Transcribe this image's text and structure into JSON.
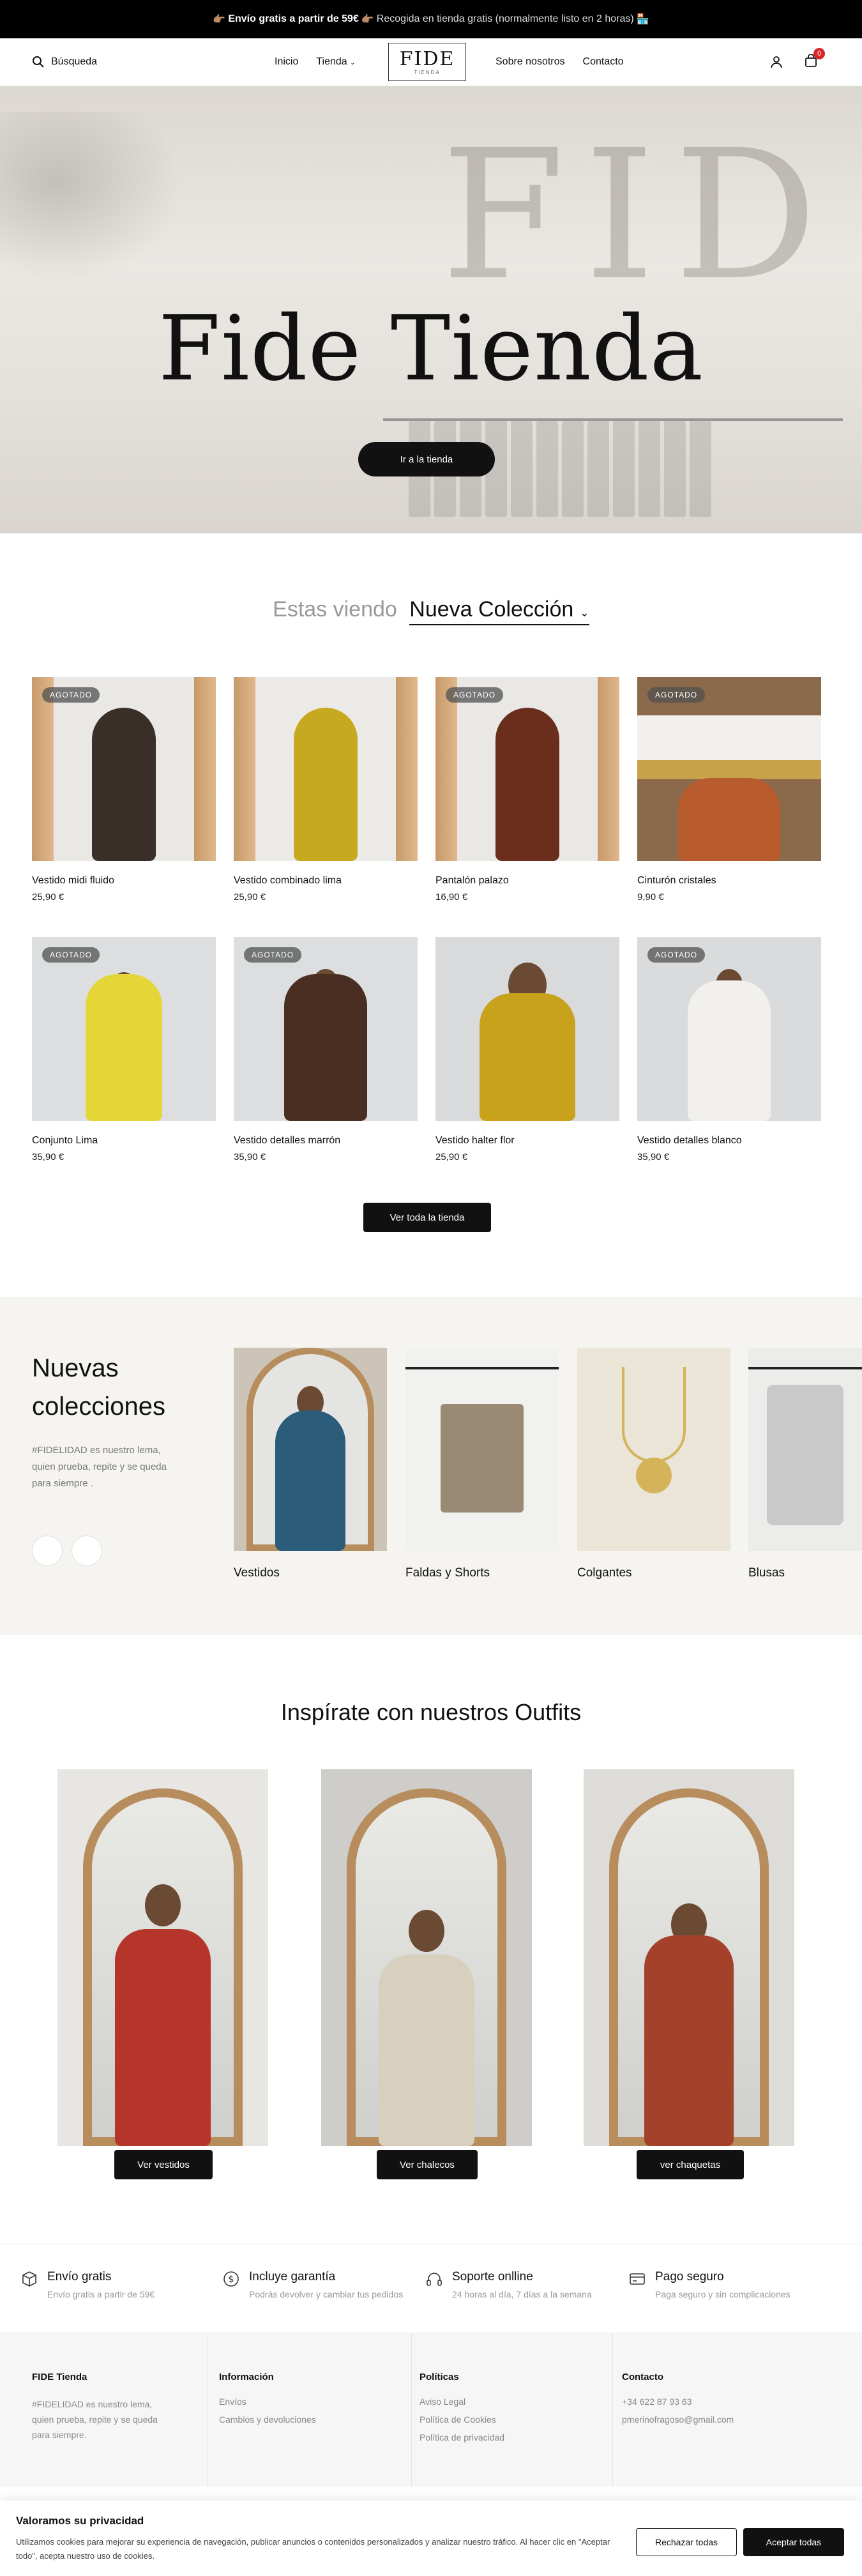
{
  "announcement": {
    "emoji_left": "👉🏽",
    "bold": "Envío gratis a partir de 59€",
    "emoji_mid": "👉🏽",
    "rest": "Recogida en tienda gratis (normalmente listo en 2 horas)",
    "emoji_right": "🏪"
  },
  "header": {
    "search_label": "Búsqueda",
    "nav": [
      "Inicio",
      "Tienda"
    ],
    "nav_right": [
      "Sobre nosotros",
      "Contacto"
    ],
    "logo_big": "FIDE",
    "logo_small": "TIENDA",
    "cart_count": "0"
  },
  "hero": {
    "title": "Fide Tienda",
    "button": "Ir a la tienda",
    "wall_text": "FID"
  },
  "collection": {
    "prefix": "Estas viendo",
    "selected": "Nueva Colección",
    "badge": "AGOTADO",
    "products": [
      {
        "name": "Vestido midi fluido",
        "price": "25,90 €",
        "soldout": true,
        "color": "#3a2f28"
      },
      {
        "name": "Vestido combinado lima",
        "price": "25,90 €",
        "soldout": false,
        "color": "#c6a91e"
      },
      {
        "name": "Pantalón palazo",
        "price": "16,90 €",
        "soldout": true,
        "color": "#6b2e1d"
      },
      {
        "name": "Cinturón cristales",
        "price": "9,90 €",
        "soldout": true,
        "color": "#b85c2e"
      },
      {
        "name": "Conjunto Lima",
        "price": "35,90 €",
        "soldout": true,
        "color": "#e4d636"
      },
      {
        "name": "Vestido detalles marrón",
        "price": "35,90 €",
        "soldout": true,
        "color": "#4a2e22"
      },
      {
        "name": "Vestido halter flor",
        "price": "25,90 €",
        "soldout": false,
        "color": "#c9a21c"
      },
      {
        "name": "Vestido detalles blanco",
        "price": "35,90 €",
        "soldout": true,
        "color": "#f1f0ec"
      }
    ],
    "view_all": "Ver toda la tienda"
  },
  "nuevas": {
    "title": "Nuevas colecciones",
    "desc": "#FIDELIDAD es nuestro lema, quien prueba, repite y se queda para siempre .",
    "items": [
      {
        "label": "Vestidos",
        "color": "#2b5d7a"
      },
      {
        "label": "Faldas y Shorts",
        "color": "#9a8a74"
      },
      {
        "label": "Colgantes",
        "color": "#d4b35a"
      },
      {
        "label": "Blusas",
        "color": "#c9c9c9"
      }
    ]
  },
  "inspire": {
    "title": "Inspírate con nuestros Outfits",
    "outfits": [
      {
        "button": "Ver vestidos",
        "color": "#b5352b"
      },
      {
        "button": "Ver chalecos",
        "color": "#d9cfbe"
      },
      {
        "button": "ver chaquetas",
        "color": "#a3412a"
      }
    ]
  },
  "features": [
    {
      "title": "Envío gratis",
      "sub": "Envío gratis a partir de 59€",
      "icon": "box-icon"
    },
    {
      "title": "Incluye garantía",
      "sub": "Podrás devolver y cambiar tus pedidos",
      "icon": "dollar-icon"
    },
    {
      "title": "Soporte onlline",
      "sub": "24 horas al día, 7 días a la semana",
      "icon": "headset-icon"
    },
    {
      "title": "Pago seguro",
      "sub": "Paga seguro y sin complicaciones",
      "icon": "card-icon"
    }
  ],
  "footer": {
    "brand": "FIDE Tienda",
    "desc": "#FIDELIDAD es nuestro lema, quien prueba, repite y se queda para siempre.",
    "info_title": "Información",
    "info_links": [
      "Envíos",
      "Cambios y devoluciones"
    ],
    "pol_title": "Políticas",
    "pol_links": [
      "Aviso Legal",
      "Política de Cookies",
      "Política de privacidad"
    ],
    "contact_title": "Contacto",
    "phone": "+34 622 87 93 63",
    "email": "pmerinofragoso@gmail.com"
  },
  "cookie": {
    "title": "Valoramos su privacidad",
    "text": "Utilizamos cookies para mejorar su experiencia de navegación, publicar anuncios o contenidos personalizados y analizar nuestro tráfico. Al hacer clic en \"Aceptar todo\", acepta nuestro uso de cookies.",
    "reject": "Rechazar todas",
    "accept": "Aceptar todas"
  }
}
